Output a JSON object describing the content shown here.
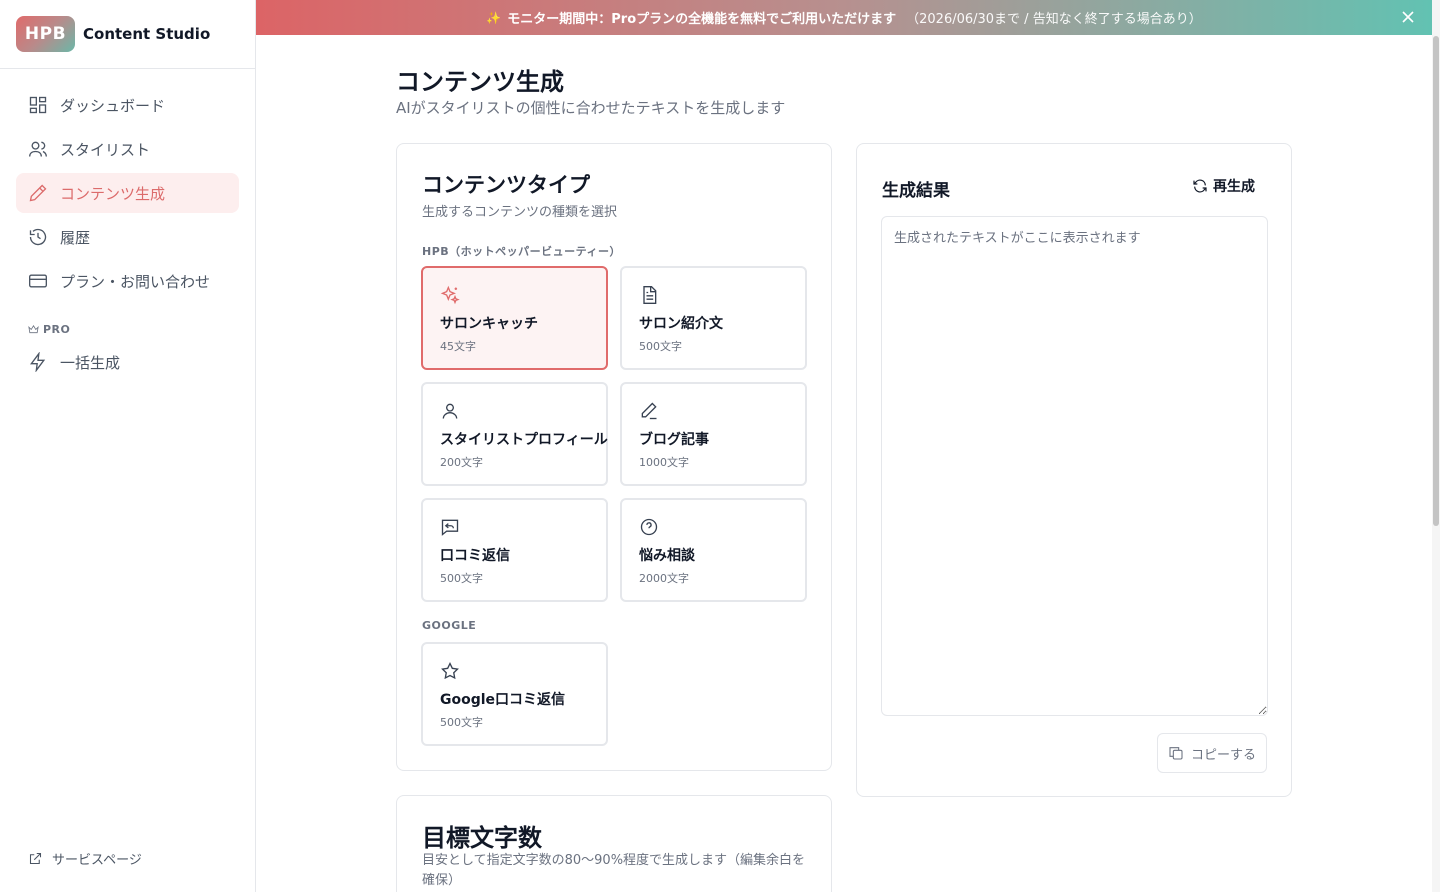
{
  "app": {
    "logo_text": "HPB",
    "name": "Content Studio"
  },
  "sidebar": {
    "items": [
      {
        "label": "ダッシュボード",
        "icon": "dashboard-icon"
      },
      {
        "label": "スタイリスト",
        "icon": "users-icon"
      },
      {
        "label": "コンテンツ生成",
        "icon": "pencil-icon",
        "active": true
      },
      {
        "label": "履歴",
        "icon": "history-icon"
      },
      {
        "label": "プラン・お問い合わせ",
        "icon": "credit-card-icon"
      }
    ],
    "pro_section_label": "PRO",
    "pro_items": [
      {
        "label": "一括生成",
        "icon": "lightning-icon"
      }
    ],
    "footer_link": "サービスページ"
  },
  "banner": {
    "highlight": "モニター期間中：Proプランの全機能を無料でご利用いただけます",
    "note": "（2026/06/30まで / 告知なく終了する場合あり）"
  },
  "page": {
    "title": "コンテンツ生成",
    "subtitle": "AIがスタイリストの個性に合わせたテキストを生成します"
  },
  "content_type": {
    "title": "コンテンツタイプ",
    "description": "生成するコンテンツの種類を選択",
    "hpb_label": "HPB（ホットペッパービューティー）",
    "hpb_options": [
      {
        "name": "サロンキャッチ",
        "count": "45文字",
        "icon": "sparkles-icon",
        "selected": true
      },
      {
        "name": "サロン紹介文",
        "count": "500文字",
        "icon": "document-icon"
      },
      {
        "name": "スタイリストプロフィール",
        "count": "200文字",
        "icon": "user-icon"
      },
      {
        "name": "ブログ記事",
        "count": "1000文字",
        "icon": "pen-icon"
      },
      {
        "name": "口コミ返信",
        "count": "500文字",
        "icon": "reply-icon"
      },
      {
        "name": "悩み相談",
        "count": "2000文字",
        "icon": "question-icon"
      }
    ],
    "google_label": "GOOGLE",
    "google_options": [
      {
        "name": "Google口コミ返信",
        "count": "500文字",
        "icon": "star-icon"
      }
    ]
  },
  "result": {
    "title": "生成結果",
    "regenerate_label": "再生成",
    "placeholder": "生成されたテキストがここに表示されます",
    "copy_label": "コピーする"
  },
  "target_length": {
    "title": "目標文字数",
    "description": "目安として指定文字数の80〜90%程度で生成します（編集余白を確保）"
  },
  "colors": {
    "accent": "#e06b6b",
    "active_bg": "#fdeeee",
    "banner_start": "#dc6466",
    "banner_end": "#62c2b2"
  }
}
